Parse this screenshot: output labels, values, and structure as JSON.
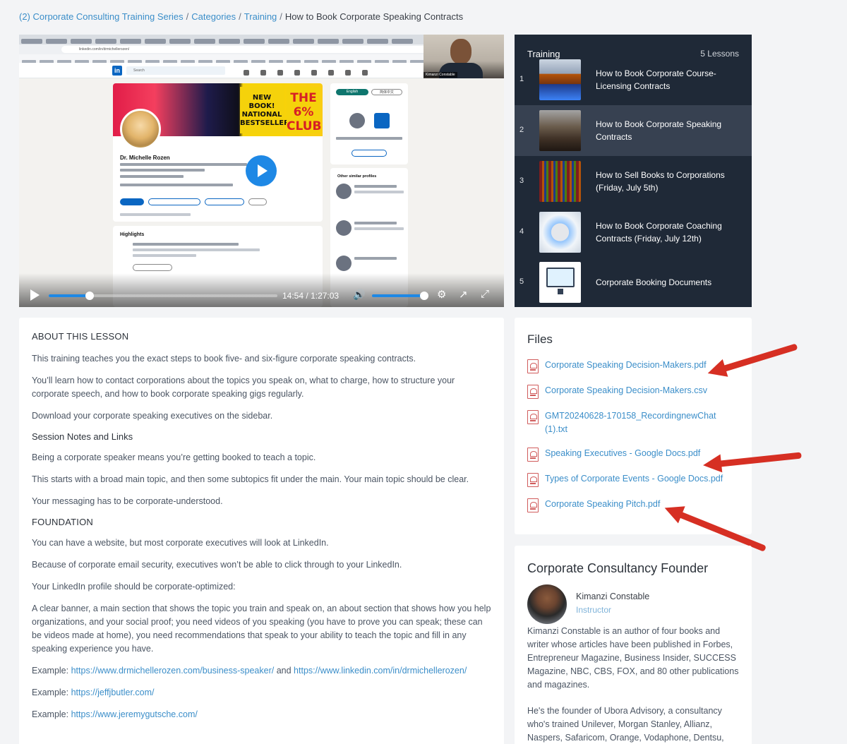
{
  "breadcrumb": {
    "items": [
      "(2) Corporate Consulting Training Series",
      "Categories",
      "Training"
    ],
    "current": "How to Book Corporate Speaking Contracts",
    "separator": "/"
  },
  "video": {
    "url_text": "linkedin.com/in/drmichellerozen/",
    "search_placeholder": "Search",
    "profile_name": "Dr. Michelle Rozen",
    "book1_text": "NEW BOOK! NATIONAL BESTSELLER",
    "book2_text": "THE 6% CLUB",
    "highlights_label": "Highlights",
    "lang_english": "English",
    "lang_chinese": "简体中文",
    "sidebar_label": "Other similar profiles",
    "cam_label": "Kimanzi Constable",
    "time_current": "14:54",
    "time_separator": "/",
    "time_total": "1:27:03",
    "progress_fraction": 0.18,
    "volume_fraction": 1.0
  },
  "lessons": {
    "title": "Training",
    "count": "5 Lessons",
    "items": [
      {
        "num": "1",
        "title": "How to Book Corporate Course-Licensing Contracts"
      },
      {
        "num": "2",
        "title": "How to Book Corporate Speaking Contracts"
      },
      {
        "num": "3",
        "title": "How to Sell Books to Corporations (Friday, July 5th)"
      },
      {
        "num": "4",
        "title": "How to Book Corporate Coaching Contracts (Friday, July 12th)"
      },
      {
        "num": "5",
        "title": "Corporate Booking Documents"
      }
    ]
  },
  "about": {
    "heading": "ABOUT THIS LESSON",
    "p1": "This training teaches you the exact steps to book five- and six-figure corporate speaking contracts.",
    "p2": "You’ll learn how to contact corporations about the topics you speak on, what to charge, how to structure your corporate speech, and how to book corporate speaking gigs regularly.",
    "p3": "Download your corporate speaking executives on the sidebar.",
    "session_heading": "Session Notes and Links",
    "p4": "Being a corporate speaker means you’re getting booked to teach a topic.",
    "p5": "This starts with a broad main topic, and then some subtopics fit under the main. Your main topic should be clear.",
    "p6": "Your messaging has to be corporate-understood.",
    "foundation_heading": "FOUNDATION",
    "p7": "You can have a website, but most corporate executives will look at LinkedIn.",
    "p8": "Because of corporate email security, executives won’t be able to click through to your LinkedIn.",
    "p9": "Your LinkedIn profile should be corporate-optimized:",
    "p10": "A clear banner, a main section that shows the topic you train and speak on, an about section that shows how you help organizations, and your social proof; you need videos of you speaking (you have to prove you can speak; these can be videos made at home), you need recommendations that speak to your ability to teach the topic and fill in any speaking experience you have.",
    "example_label": "Example:",
    "example1_link1": "https://www.drmichellerozen.com/business-speaker/",
    "example1_and": "and",
    "example1_link2": "https://www.linkedin.com/in/drmichellerozen/",
    "example2_link": "https://jeffjbutler.com/",
    "example3_link": "https://www.jeremygutsche.com/"
  },
  "files": {
    "title": "Files",
    "items": [
      {
        "name": "Corporate Speaking Decision-Makers.pdf"
      },
      {
        "name": "Corporate Speaking Decision-Makers.csv"
      },
      {
        "name": "GMT20240628-170158_RecordingnewChat (1).txt"
      },
      {
        "name": "Speaking Executives - Google Docs.pdf"
      },
      {
        "name": "Types of Corporate Events - Google Docs.pdf"
      },
      {
        "name": "Corporate Speaking Pitch.pdf"
      }
    ]
  },
  "founder": {
    "title": "Corporate Consultancy Founder",
    "name": "Kimanzi Constable",
    "role": "Instructor",
    "bio1": "Kimanzi Constable is an author of four books and writer whose articles have been published in Forbes, Entrepreneur Magazine, Business Insider, SUCCESS Magazine, NBC, CBS, FOX, and 80 other publications and magazines.",
    "bio2": "He's the founder of Ubora Advisory, a consultancy who's trained Unilever, Morgan Stanley, Allianz, Naspers, Safaricom, Orange, Vodaphone, Dentsu,"
  },
  "colors": {
    "link": "#3b8ec9",
    "sidebar_bg": "#1f2937",
    "play_button": "#1e88e5",
    "annotation_arrow": "#d62f23"
  }
}
